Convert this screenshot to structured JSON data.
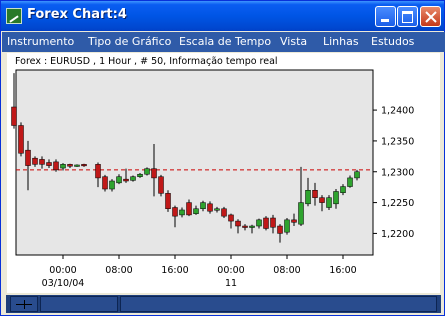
{
  "window": {
    "title": "Forex Chart:4"
  },
  "menu": [
    "Instrumento",
    "Tipo de Gráfico",
    "Escala de Tempo",
    "Vista",
    "Linhas",
    "Estudos"
  ],
  "chart_header": "Forex : EURUSD , 1 Hour , # 50, Informação tempo real",
  "colors": {
    "up": "#2ea32e",
    "down": "#c01818",
    "reference_line": "#cc0000",
    "plot_bg": "#e6e6e6",
    "titlebar": "#0055e5",
    "menubar": "#2f5ba8"
  },
  "chart_data": {
    "type": "candlestick",
    "instrument": "EURUSD",
    "timeframe": "1 Hour",
    "bars_count": 50,
    "ylim": [
      1.2165,
      1.2465
    ],
    "y_ticks": [
      "1,2400",
      "1,2350",
      "1,2300",
      "1,2250",
      "1,2200"
    ],
    "x_ticks": [
      {
        "label": "00:00",
        "sub": "03/10/04",
        "hour": 0
      },
      {
        "label": "08:00",
        "sub": "",
        "hour": 8
      },
      {
        "label": "16:00",
        "sub": "",
        "hour": 16
      },
      {
        "label": "00:00",
        "sub": "11",
        "hour": 24
      },
      {
        "label": "08:00",
        "sub": "",
        "hour": 32
      },
      {
        "label": "16:00",
        "sub": "",
        "hour": 40
      }
    ],
    "reference_price": 1.2303,
    "candles": [
      {
        "h": -7,
        "o": 1.2405,
        "c": 1.2375,
        "hi": 1.246,
        "lo": 1.237
      },
      {
        "h": -6,
        "o": 1.2375,
        "c": 1.233,
        "hi": 1.238,
        "lo": 1.2325
      },
      {
        "h": -5,
        "o": 1.2335,
        "c": 1.231,
        "hi": 1.235,
        "lo": 1.227
      },
      {
        "h": -4,
        "o": 1.2322,
        "c": 1.2312,
        "hi": 1.2325,
        "lo": 1.2308
      },
      {
        "h": -3,
        "o": 1.232,
        "c": 1.2312,
        "hi": 1.2325,
        "lo": 1.2305
      },
      {
        "h": -2,
        "o": 1.2315,
        "c": 1.231,
        "hi": 1.232,
        "lo": 1.2306
      },
      {
        "h": -1,
        "o": 1.2316,
        "c": 1.2303,
        "hi": 1.232,
        "lo": 1.23
      },
      {
        "h": 0,
        "o": 1.2306,
        "c": 1.2312,
        "hi": 1.2314,
        "lo": 1.2302
      },
      {
        "h": 1,
        "o": 1.2312,
        "c": 1.2309,
        "hi": 1.2313,
        "lo": 1.2306
      },
      {
        "h": 2,
        "o": 1.231,
        "c": 1.2311,
        "hi": 1.2312,
        "lo": 1.2308
      },
      {
        "h": 3,
        "o": 1.2312,
        "c": 1.231,
        "hi": 1.2313,
        "lo": 1.2308
      },
      {
        "h": 5,
        "o": 1.2312,
        "c": 1.229,
        "hi": 1.2315,
        "lo": 1.2275
      },
      {
        "h": 6,
        "o": 1.2292,
        "c": 1.2272,
        "hi": 1.2295,
        "lo": 1.2268
      },
      {
        "h": 7,
        "o": 1.2272,
        "c": 1.2285,
        "hi": 1.2288,
        "lo": 1.2268
      },
      {
        "h": 8,
        "o": 1.2282,
        "c": 1.2292,
        "hi": 1.2296,
        "lo": 1.228
      },
      {
        "h": 9,
        "o": 1.2288,
        "c": 1.2285,
        "hi": 1.2305,
        "lo": 1.2282
      },
      {
        "h": 10,
        "o": 1.2286,
        "c": 1.2292,
        "hi": 1.2294,
        "lo": 1.2284
      },
      {
        "h": 11,
        "o": 1.2292,
        "c": 1.2296,
        "hi": 1.2298,
        "lo": 1.229
      },
      {
        "h": 12,
        "o": 1.2296,
        "c": 1.2305,
        "hi": 1.2307,
        "lo": 1.2294
      },
      {
        "h": 13,
        "o": 1.2305,
        "c": 1.229,
        "hi": 1.2345,
        "lo": 1.226
      },
      {
        "h": 14,
        "o": 1.2292,
        "c": 1.2265,
        "hi": 1.2295,
        "lo": 1.226
      },
      {
        "h": 15,
        "o": 1.2265,
        "c": 1.224,
        "hi": 1.227,
        "lo": 1.2235
      },
      {
        "h": 16,
        "o": 1.2242,
        "c": 1.2228,
        "hi": 1.2245,
        "lo": 1.221
      },
      {
        "h": 17,
        "o": 1.223,
        "c": 1.2238,
        "hi": 1.2242,
        "lo": 1.2226
      },
      {
        "h": 18,
        "o": 1.225,
        "c": 1.223,
        "hi": 1.2255,
        "lo": 1.2228
      },
      {
        "h": 19,
        "o": 1.2232,
        "c": 1.224,
        "hi": 1.2245,
        "lo": 1.223
      },
      {
        "h": 20,
        "o": 1.224,
        "c": 1.225,
        "hi": 1.2253,
        "lo": 1.2236
      },
      {
        "h": 21,
        "o": 1.2248,
        "c": 1.2236,
        "hi": 1.2252,
        "lo": 1.2232
      },
      {
        "h": 22,
        "o": 1.2238,
        "c": 1.224,
        "hi": 1.2243,
        "lo": 1.2234
      },
      {
        "h": 23,
        "o": 1.224,
        "c": 1.2228,
        "hi": 1.2243,
        "lo": 1.2225
      },
      {
        "h": 24,
        "o": 1.223,
        "c": 1.222,
        "hi": 1.2232,
        "lo": 1.2208
      },
      {
        "h": 25,
        "o": 1.222,
        "c": 1.2212,
        "hi": 1.2223,
        "lo": 1.22
      },
      {
        "h": 26,
        "o": 1.2212,
        "c": 1.221,
        "hi": 1.2215,
        "lo": 1.2205
      },
      {
        "h": 27,
        "o": 1.221,
        "c": 1.2212,
        "hi": 1.2214,
        "lo": 1.22
      },
      {
        "h": 28,
        "o": 1.2212,
        "c": 1.2222,
        "hi": 1.2224,
        "lo": 1.2208
      },
      {
        "h": 29,
        "o": 1.2225,
        "c": 1.2208,
        "hi": 1.2228,
        "lo": 1.2205
      },
      {
        "h": 30,
        "o": 1.2225,
        "c": 1.221,
        "hi": 1.223,
        "lo": 1.22
      },
      {
        "h": 31,
        "o": 1.2212,
        "c": 1.22,
        "hi": 1.2215,
        "lo": 1.2185
      },
      {
        "h": 32,
        "o": 1.2202,
        "c": 1.2222,
        "hi": 1.2225,
        "lo": 1.2198
      },
      {
        "h": 33,
        "o": 1.2222,
        "c": 1.2218,
        "hi": 1.2232,
        "lo": 1.2212
      },
      {
        "h": 34,
        "o": 1.2215,
        "c": 1.225,
        "hi": 1.2308,
        "lo": 1.2212
      },
      {
        "h": 35,
        "o": 1.2248,
        "c": 1.227,
        "hi": 1.229,
        "lo": 1.2244
      },
      {
        "h": 36,
        "o": 1.227,
        "c": 1.2258,
        "hi": 1.2282,
        "lo": 1.2245
      },
      {
        "h": 37,
        "o": 1.2258,
        "c": 1.225,
        "hi": 1.2262,
        "lo": 1.2236
      },
      {
        "h": 38,
        "o": 1.2242,
        "c": 1.2258,
        "hi": 1.2262,
        "lo": 1.2238
      },
      {
        "h": 39,
        "o": 1.2248,
        "c": 1.2268,
        "hi": 1.2272,
        "lo": 1.224
      },
      {
        "h": 40,
        "o": 1.2266,
        "c": 1.2276,
        "hi": 1.228,
        "lo": 1.2262
      },
      {
        "h": 41,
        "o": 1.2276,
        "c": 1.229,
        "hi": 1.2294,
        "lo": 1.2274
      },
      {
        "h": 42,
        "o": 1.229,
        "c": 1.23,
        "hi": 1.2303,
        "lo": 1.2286
      }
    ]
  }
}
